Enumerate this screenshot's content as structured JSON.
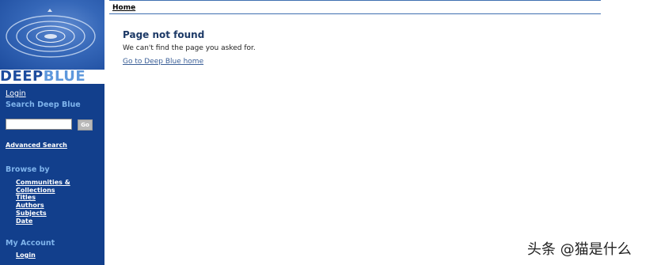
{
  "logo": {
    "word_left": "DEEP",
    "word_right": "BLUE"
  },
  "sidebar": {
    "login": "Login",
    "search_heading": "Search Deep Blue",
    "go_label": "Go",
    "advanced_search": "Advanced Search",
    "browse_heading": "Browse by",
    "browse_items": [
      "Communities &",
      "Collections",
      "Titles",
      "Authors",
      "Subjects",
      "Date"
    ],
    "account_heading": "My Account",
    "account_login": "Login"
  },
  "breadcrumb": {
    "home": "Home"
  },
  "main": {
    "title": "Page not found",
    "message": "We can't find the page you asked for.",
    "home_link": "Go to Deep Blue home"
  },
  "watermark": "头条 @猫是什么",
  "colors": {
    "sidebar_bg": "#123f8c",
    "heading_blue": "#7fb4ec",
    "title_color": "#1c3966",
    "link_color": "#3b5f97"
  }
}
